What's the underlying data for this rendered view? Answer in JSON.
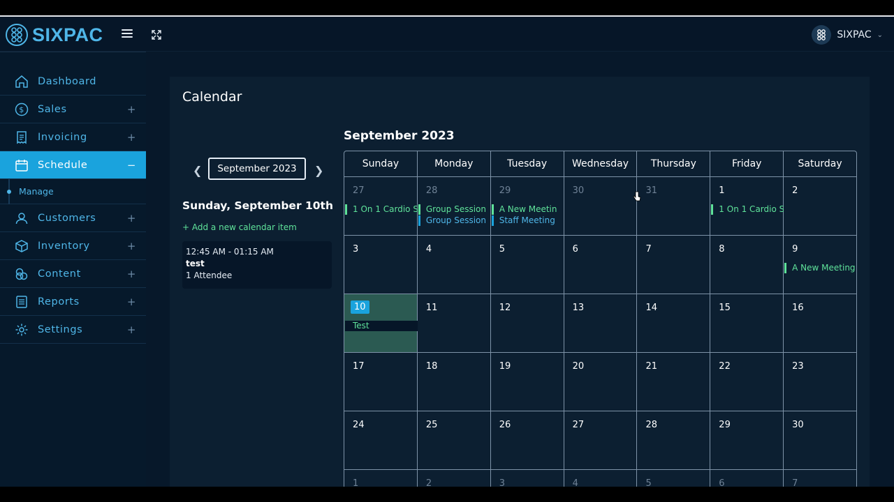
{
  "brand": {
    "name": "SIXPAC"
  },
  "user": {
    "name": "SIXPAC"
  },
  "sidebar": {
    "items": [
      {
        "label": "Dashboard",
        "icon": "home-icon",
        "plus": ""
      },
      {
        "label": "Sales",
        "icon": "dollar-icon",
        "plus": "+"
      },
      {
        "label": "Invoicing",
        "icon": "receipt-icon",
        "plus": "+"
      },
      {
        "label": "Schedule",
        "icon": "calendar-icon",
        "plus": "−"
      },
      {
        "label": "Customers",
        "icon": "user-icon",
        "plus": "+"
      },
      {
        "label": "Inventory",
        "icon": "box-icon",
        "plus": "+"
      },
      {
        "label": "Content",
        "icon": "content-icon",
        "plus": "+"
      },
      {
        "label": "Reports",
        "icon": "report-icon",
        "plus": "+"
      },
      {
        "label": "Settings",
        "icon": "gear-icon",
        "plus": "+"
      }
    ],
    "sub_item": "Manage"
  },
  "panel": {
    "title": "Calendar",
    "month_picker": "September 2023",
    "selected_day": "Sunday, September 10th",
    "add_item": "+ Add a new calendar item",
    "event_card": {
      "time": "12:45 AM - 01:15 AM",
      "name": "test",
      "attendees": "1 Attendee"
    }
  },
  "calendar": {
    "title": "September 2023",
    "weekdays": [
      "Sunday",
      "Monday",
      "Tuesday",
      "Wednesday",
      "Thursday",
      "Friday",
      "Saturday"
    ],
    "weeks": [
      [
        "27",
        "28",
        "29",
        "30",
        "31",
        "1",
        "2"
      ],
      [
        "3",
        "4",
        "5",
        "6",
        "7",
        "8",
        "9"
      ],
      [
        "10",
        "11",
        "12",
        "13",
        "14",
        "15",
        "16"
      ],
      [
        "17",
        "18",
        "19",
        "20",
        "21",
        "22",
        "23"
      ],
      [
        "24",
        "25",
        "26",
        "27",
        "28",
        "29",
        "30"
      ],
      [
        "1",
        "2",
        "3",
        "4",
        "5",
        "6",
        "7"
      ]
    ],
    "events": {
      "w0d0": [
        {
          "text": "1 On 1 Cardio S",
          "color": "green"
        }
      ],
      "w0d1": [
        {
          "text": "Group Session",
          "color": "green"
        },
        {
          "text": "Group Session",
          "color": "blue"
        }
      ],
      "w0d2": [
        {
          "text": "A New Meetin",
          "color": "green"
        },
        {
          "text": "Staff Meeting",
          "color": "blue"
        }
      ],
      "w0d5": [
        {
          "text": "1 On 1 Cardio S",
          "color": "green"
        }
      ],
      "w1d6": [
        {
          "text": "A New Meeting",
          "color": "green"
        }
      ],
      "w2d0": [
        {
          "text": "Test",
          "color": "dark"
        }
      ]
    }
  },
  "colors": {
    "accent": "#1aa3dd",
    "green": "#5fe39a",
    "bg": "#07182a"
  }
}
